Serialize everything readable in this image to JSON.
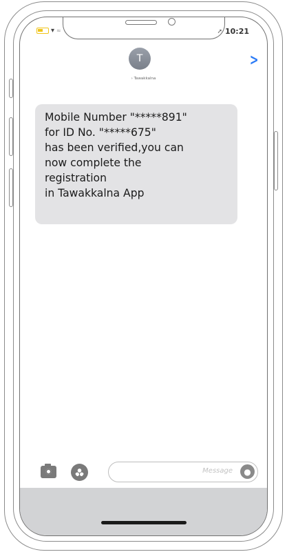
{
  "status_bar": {
    "carrier": "≈",
    "time": "10:21"
  },
  "header": {
    "avatar_initial": "T",
    "contact_name": "Tawakkalna"
  },
  "message": {
    "lines": [
      "Mobile Number \"*****891\"",
      "for ID No. \"*****675\"",
      "has been verified,you can",
      "now complete the",
      "registration",
      "in Tawakkalna App"
    ]
  },
  "composer": {
    "placeholder": "Message"
  },
  "colors": {
    "link": "#2d7cf6",
    "bubble": "#e3e3e5",
    "battery": "#f0c419"
  }
}
